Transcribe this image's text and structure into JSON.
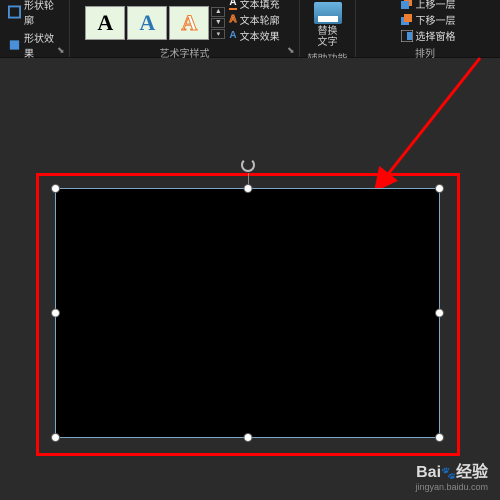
{
  "ribbon": {
    "shape_group": {
      "outline": "形状轮廓",
      "effects": "形状效果"
    },
    "wordart_group": {
      "label": "艺术字样式",
      "text_fill": "文本填充",
      "text_outline": "文本轮廓",
      "text_effects": "文本效果"
    },
    "accessibility_group": {
      "label": "辅助功能",
      "alt_text_line1": "替换",
      "alt_text_line2": "文字"
    },
    "arrange_group": {
      "label": "排列",
      "bring_forward": "上移一层",
      "send_backward": "下移一层",
      "selection_pane": "选择窗格"
    }
  },
  "wordart_samples": [
    "A",
    "A",
    "A"
  ],
  "watermark": {
    "brand_prefix": "Bai",
    "brand_suffix": "经验",
    "site": "jingyan.baidu.com"
  },
  "annotation": {
    "arrow_color": "#ff0000",
    "box_color": "#ff0000"
  }
}
